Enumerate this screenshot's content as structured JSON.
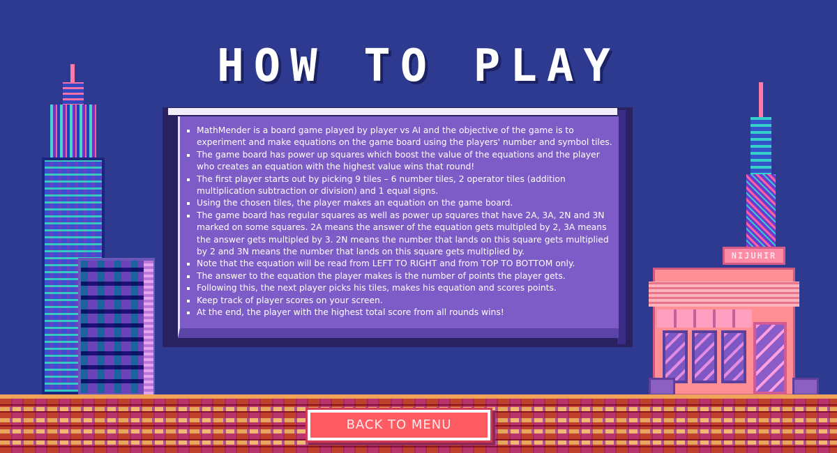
{
  "screen": {
    "title": "HOW TO PLAY",
    "shop_sign": "NIJUHIR"
  },
  "rules": [
    "MathMender is a board game played by player vs AI and the objective of the game is to experiment and make equations on the game board using the players' number and symbol tiles.",
    "The game board has power up squares which boost the value of the equations and the player who creates an equation with the highest value wins that round!",
    "The first player starts out by picking 9 tiles – 6 number tiles, 2 operator tiles (addition multiplication subtraction or division) and 1 equal signs.",
    "Using the chosen tiles, the player makes an equation on the game board.",
    "The game board has regular squares as well as power up squares that have 2A, 3A, 2N and 3N marked on some squares. 2A means the answer of the equation gets multipled by 2, 3A means the answer gets multipled by 3. 2N means the number that lands on this square gets multiplied by 2 and 3N means the number that lands on this square gets multiplied by.",
    "Note that the equation will be read from LEFT TO RIGHT and from TOP TO BOTTOM only.",
    "The answer to the equation the player makes is the number of points the player gets.",
    "Following this, the next player picks his tiles, makes his equation and scores points.",
    "Keep track of player scores on your screen.",
    "At the end, the player with the highest total score from all rounds wins!"
  ],
  "buttons": {
    "back_to_menu": "BACK TO MENU"
  },
  "colors": {
    "background": "#2e3a8f",
    "panel": "#7e5cc8",
    "button": "#ff5b63"
  }
}
